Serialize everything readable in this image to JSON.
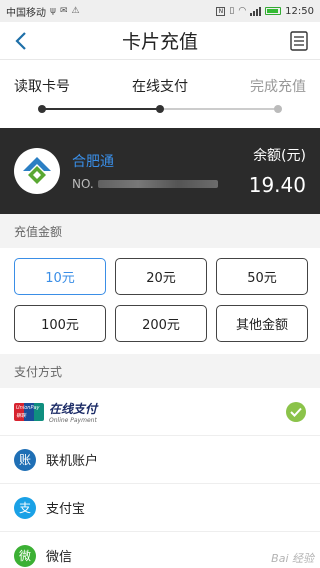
{
  "status_bar": {
    "carrier": "中国移动",
    "time": "12:50"
  },
  "header": {
    "title": "卡片充值"
  },
  "steps": [
    {
      "label": "读取卡号",
      "state": "done"
    },
    {
      "label": "在线支付",
      "state": "current"
    },
    {
      "label": "完成充值",
      "state": "pending"
    }
  ],
  "card": {
    "name": "合肥通",
    "number_prefix": "NO.",
    "balance_label": "余额(元)",
    "balance_value": "19.40"
  },
  "amount_section": {
    "title": "充值金额",
    "options": [
      {
        "label": "10元",
        "selected": true
      },
      {
        "label": "20元",
        "selected": false
      },
      {
        "label": "50元",
        "selected": false
      },
      {
        "label": "100元",
        "selected": false
      },
      {
        "label": "200元",
        "selected": false
      },
      {
        "label": "其他金额",
        "selected": false
      }
    ]
  },
  "payment_section": {
    "title": "支付方式",
    "methods": [
      {
        "label": "在线支付",
        "sub_label": "Online Payment",
        "badge_text": "UnionPay 银联",
        "icon": "unionpay-icon",
        "selected": true
      },
      {
        "label": "联机账户",
        "icon": "account-icon",
        "glyph": "账",
        "color": "#1f6fb5",
        "selected": false
      },
      {
        "label": "支付宝",
        "icon": "alipay-icon",
        "glyph": "支",
        "color": "#1aa1e6",
        "selected": false
      },
      {
        "label": "微信",
        "icon": "wechat-icon",
        "glyph": "微",
        "color": "#3cb034",
        "selected": false
      }
    ]
  },
  "watermark": "Bai 经验",
  "colors": {
    "accent": "#3a8ee6",
    "card_bg": "#2b2b2b",
    "check": "#8bc34a"
  }
}
